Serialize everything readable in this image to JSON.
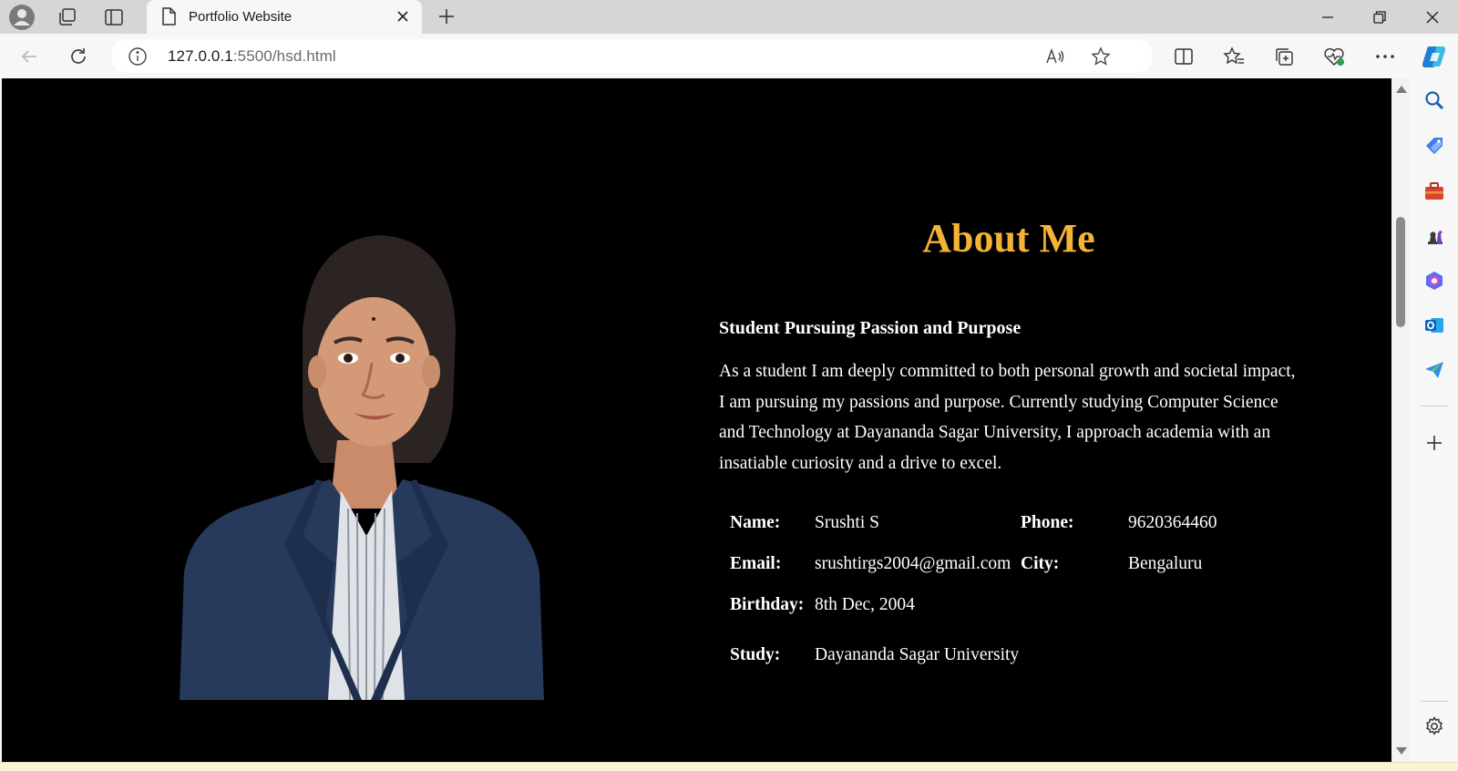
{
  "browser": {
    "tab": {
      "title": "Portfolio Website"
    },
    "address": {
      "host": "127.0.0.1",
      "rest": ":5500/hsd.html"
    }
  },
  "about": {
    "title": "About Me",
    "subtitle": "Student Pursuing Passion and Purpose",
    "paragraph": "As a student I am deeply committed to both personal growth and societal impact, I am pursuing my passions and purpose. Currently studying Computer Science and Technology at Dayananda Sagar University, I approach academia with an insatiable curiosity and a drive to excel.",
    "details": [
      {
        "label": "Name:",
        "value": "Srushti S",
        "label2": "Phone:",
        "value2": "9620364460"
      },
      {
        "label": "Email:",
        "value": "srushtirgs2004@gmail.com",
        "label2": "City:",
        "value2": "Bengaluru"
      },
      {
        "label": "Birthday:",
        "value": "8th Dec, 2004",
        "label2": "",
        "value2": ""
      },
      {
        "label": "Study:",
        "value": "Dayananda Sagar University",
        "label2": "",
        "value2": ""
      }
    ]
  },
  "colors": {
    "accent": "#f5b335",
    "page_bg": "#000000"
  },
  "icons": {
    "tab_bar": [
      "profile-icon",
      "workspaces-icon",
      "vertical-tabs-icon",
      "page-icon",
      "close-icon",
      "new-tab-icon"
    ],
    "toolbar": [
      "back-icon",
      "refresh-icon",
      "info-icon",
      "read-aloud-icon",
      "favorite-star-icon",
      "split-screen-icon",
      "favorites-icon",
      "collections-icon",
      "browser-essentials-icon",
      "more-icon",
      "copilot-icon"
    ],
    "sidebar": [
      "search-icon",
      "shopping-icon",
      "tools-icon",
      "games-icon",
      "office-icon",
      "outlook-icon",
      "send-icon",
      "add-icon",
      "settings-icon"
    ]
  }
}
